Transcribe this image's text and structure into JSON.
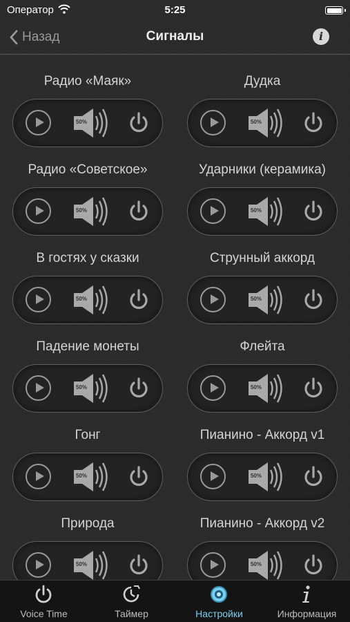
{
  "status": {
    "carrier": "Оператор",
    "time": "5:25"
  },
  "nav": {
    "back_label": "Назад",
    "title": "Сигналы",
    "info_label": "i"
  },
  "volume_text": "50%",
  "signals": [
    "Радио «Маяк»",
    "Дудка",
    "Радио «Советское»",
    "Ударники (керамика)",
    "В гостях у сказки",
    "Струнный аккорд",
    "Падение монеты",
    "Флейта",
    "Гонг",
    "Пианино - Аккорд v1",
    "Природа",
    "Пианино - Аккорд v2"
  ],
  "tabs": [
    {
      "label": "Voice Time",
      "icon": "power-icon"
    },
    {
      "label": "Таймер",
      "icon": "timer-icon"
    },
    {
      "label": "Настройки",
      "icon": "settings-icon",
      "active": true
    },
    {
      "label": "Информация",
      "icon": "info-icon"
    }
  ],
  "colors": {
    "active_tab": "#7ad0f0",
    "background": "#2a2a2a"
  }
}
